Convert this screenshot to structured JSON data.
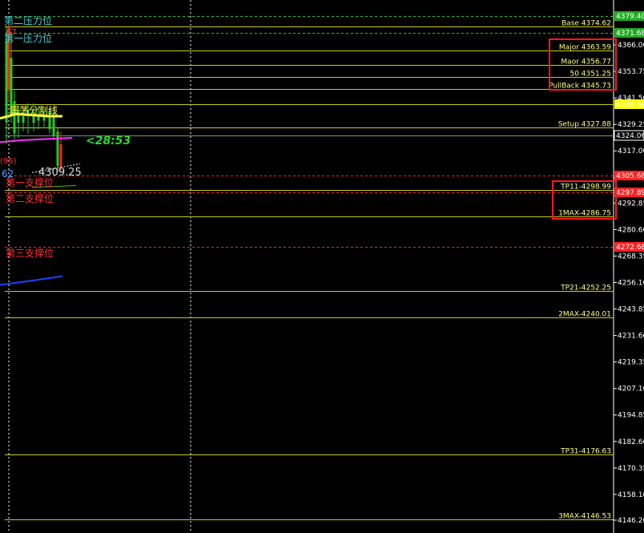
{
  "colors": {
    "background": "#000000",
    "level_line": "#c8c820",
    "resistance_line": "#30c030",
    "support_line": "#ff2020",
    "axis_text": "#ffffff",
    "highlight_box": "#ff1a1a",
    "timer_text": "#22dd22",
    "green_badge": "#22aa22",
    "red_badge": "#ff2020",
    "yellow_badge": "#ffff00"
  },
  "price_axis_ticks": [
    "4366.00",
    "4353.75",
    "4341.50",
    "4329.25",
    "4317.00",
    "4304.75",
    "4292.85",
    "4280.60",
    "4268.35",
    "4256.10",
    "4243.85",
    "4231.60",
    "4219.35",
    "4207.10",
    "4194.85",
    "4182.60",
    "4170.35",
    "4158.10",
    "4146.20"
  ],
  "level_labels": [
    {
      "text": "Base 4374.62",
      "price": 4374.62,
      "kind": "level"
    },
    {
      "text": "Major 4363.59",
      "price": 4363.59,
      "kind": "level"
    },
    {
      "text": "Maor 4356.77",
      "price": 4356.77,
      "kind": "level"
    },
    {
      "text": "50 4351.25",
      "price": 4351.25,
      "kind": "level"
    },
    {
      "text": "PullBack 4345.73",
      "price": 4345.73,
      "kind": "level"
    },
    {
      "text": "Setup 4327.88",
      "price": 4327.88,
      "kind": "level"
    },
    {
      "text": "TP11-4298.99",
      "price": 4298.99,
      "kind": "level"
    },
    {
      "text": "1MAX-4286.75",
      "price": 4286.75,
      "kind": "level"
    },
    {
      "text": "TP21-4252.25",
      "price": 4252.25,
      "kind": "level"
    },
    {
      "text": "2MAX-4240.01",
      "price": 4240.01,
      "kind": "level"
    },
    {
      "text": "TP31-4176.63",
      "price": 4176.63,
      "kind": "level"
    },
    {
      "text": "3MAX-4146.53",
      "price": 4146.53,
      "kind": "level"
    }
  ],
  "price_badges": [
    {
      "text": "4379.40",
      "kind": "green"
    },
    {
      "text": "4371.68",
      "kind": "green"
    },
    {
      "text": "4338.68",
      "kind": "yellow"
    },
    {
      "text": "4324.06",
      "kind": "current"
    },
    {
      "text": "4305.68",
      "kind": "red"
    },
    {
      "text": "4297.89",
      "kind": "red"
    },
    {
      "text": "4272.68",
      "kind": "red"
    }
  ],
  "chinese_labels": [
    {
      "text": "第二压力位",
      "color": "#40d0d0"
    },
    {
      "text": "第一压力位",
      "color": "#40d0d0"
    },
    {
      "text": "震荡分割线",
      "color": "#ffff40"
    },
    {
      "text": "第一支撑位",
      "color": "#ff3030"
    },
    {
      "text": "第二支撑位",
      "color": "#ff3030"
    },
    {
      "text": "第三支撑位",
      "color": "#ff3030"
    }
  ],
  "timer": "<28:53",
  "current_price_text": "4309.25",
  "fragments": {
    "left_62": "62",
    "left_95": "(95)",
    "left_67": "67"
  }
}
